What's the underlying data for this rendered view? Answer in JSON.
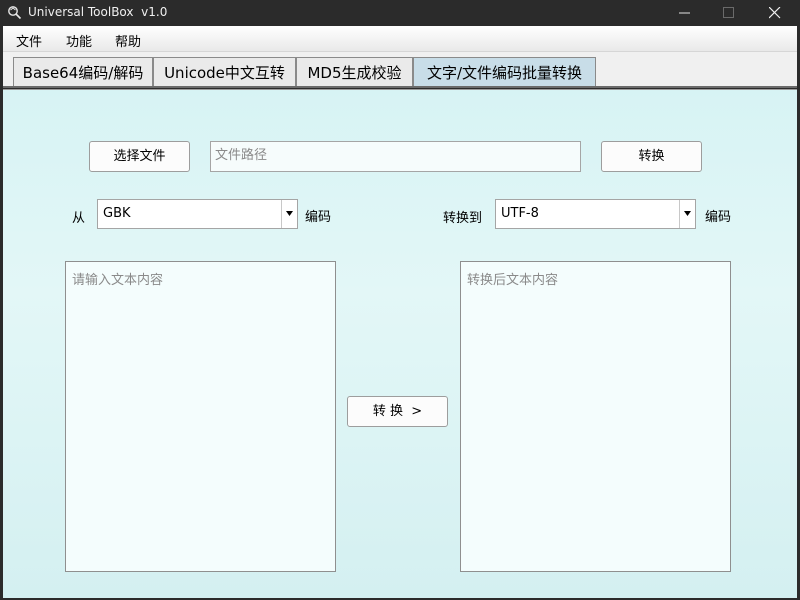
{
  "window": {
    "title": "Universal ToolBox  v1.0",
    "app_icon": "magnifier-icon",
    "controls": [
      "minimize-icon",
      "maximize-icon",
      "close-icon"
    ]
  },
  "menu": {
    "items": [
      {
        "label": "文件"
      },
      {
        "label": "功能"
      },
      {
        "label": "帮助"
      }
    ]
  },
  "tabs": [
    {
      "label": "Base64编码/解码",
      "active": false
    },
    {
      "label": "Unicode中文互转",
      "active": false
    },
    {
      "label": "MD5生成校验",
      "active": false
    },
    {
      "label": "文字/文件编码批量转换",
      "active": true
    }
  ],
  "file_row": {
    "choose_button": "选择文件",
    "path_placeholder": "文件路径",
    "convert_button": "转换"
  },
  "encoding_row": {
    "from_label": "从",
    "from_value": "GBK",
    "from_suffix": "编码",
    "to_label": "转换到",
    "to_value": "UTF-8",
    "to_suffix": "编码"
  },
  "text_convert": {
    "input_placeholder": "请输入文本内容",
    "output_placeholder": "转换后文本内容",
    "convert_button": "转 换  >"
  },
  "colors": {
    "titlebar": "#2b2b2b",
    "active_tab": "#c8dde8",
    "content_bg": "#d7f3f4"
  }
}
